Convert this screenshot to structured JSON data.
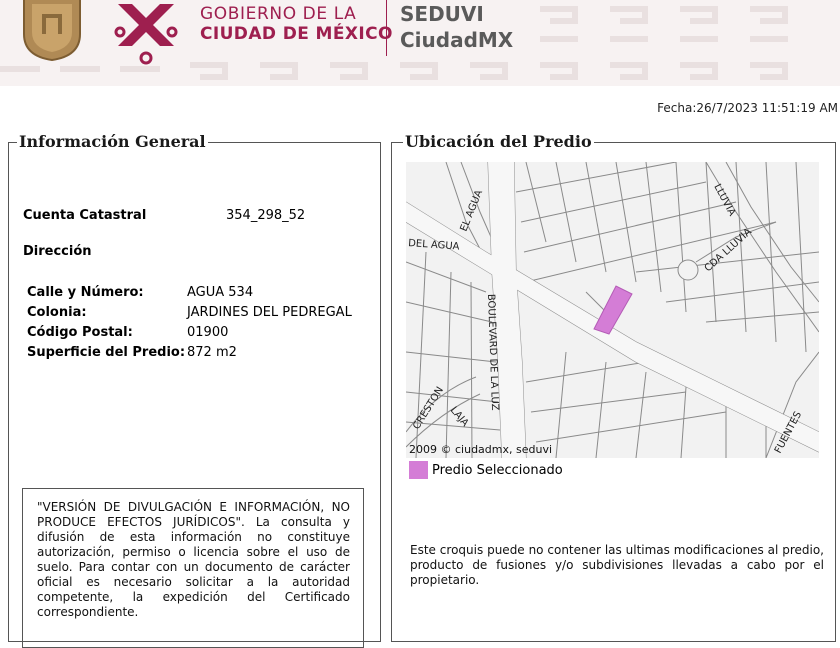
{
  "header": {
    "gov_line1": "GOBIERNO DE LA",
    "gov_line2": "CIUDAD DE MÉXICO",
    "agency_line1": "SEDUVI",
    "agency_line2": "CiudadMX",
    "brand_color": "#9e1f4f",
    "agency_color": "#5a5a5a"
  },
  "fecha": "Fecha:26/7/2023 11:51:19 AM",
  "general": {
    "title": "Información General",
    "cuenta_label": "Cuenta Catastral",
    "cuenta_value": "354_298_52",
    "direccion_label": "Dirección",
    "fields": [
      {
        "label": "Calle y Número:",
        "value": "AGUA 534"
      },
      {
        "label": "Colonia:",
        "value": "JARDINES DEL PEDREGAL"
      },
      {
        "label": "Código Postal:",
        "value": "01900"
      },
      {
        "label": "Superficie del Predio:",
        "value": "872 m2"
      }
    ],
    "disclaimer": "\"VERSIÓN DE DIVULGACIÓN E INFORMACIÓN, NO PRODUCE EFECTOS JURÍDICOS\". La consulta y difusión de esta información no constituye autorización, permiso o licencia sobre el uso de suelo. Para contar con un documento de carácter oficial es necesario solicitar a la autoridad competente, la expedición del Certificado correspondiente."
  },
  "ubicacion": {
    "title": "Ubicación del Predio",
    "map_labels": {
      "del_agua": "DEL AGUA",
      "el_agua": "EL AGUA",
      "lluvia": "LLUVIA",
      "cda_lluvia": "CDA LLUVIA",
      "boulevard": "BOULEVARD DE LA LUZ",
      "creston": "CRESTON",
      "laja": "LAJA",
      "fuentes": "FUENTES"
    },
    "credit": "2009 © ciudadmx, seduvi",
    "legend_label": "Predio Seleccionado",
    "predio_color": "#d47dd6",
    "note": "Este croquis puede no contener las ultimas modificaciones al predio, producto de fusiones y/o subdivisiones llevadas a cabo por el propietario."
  }
}
